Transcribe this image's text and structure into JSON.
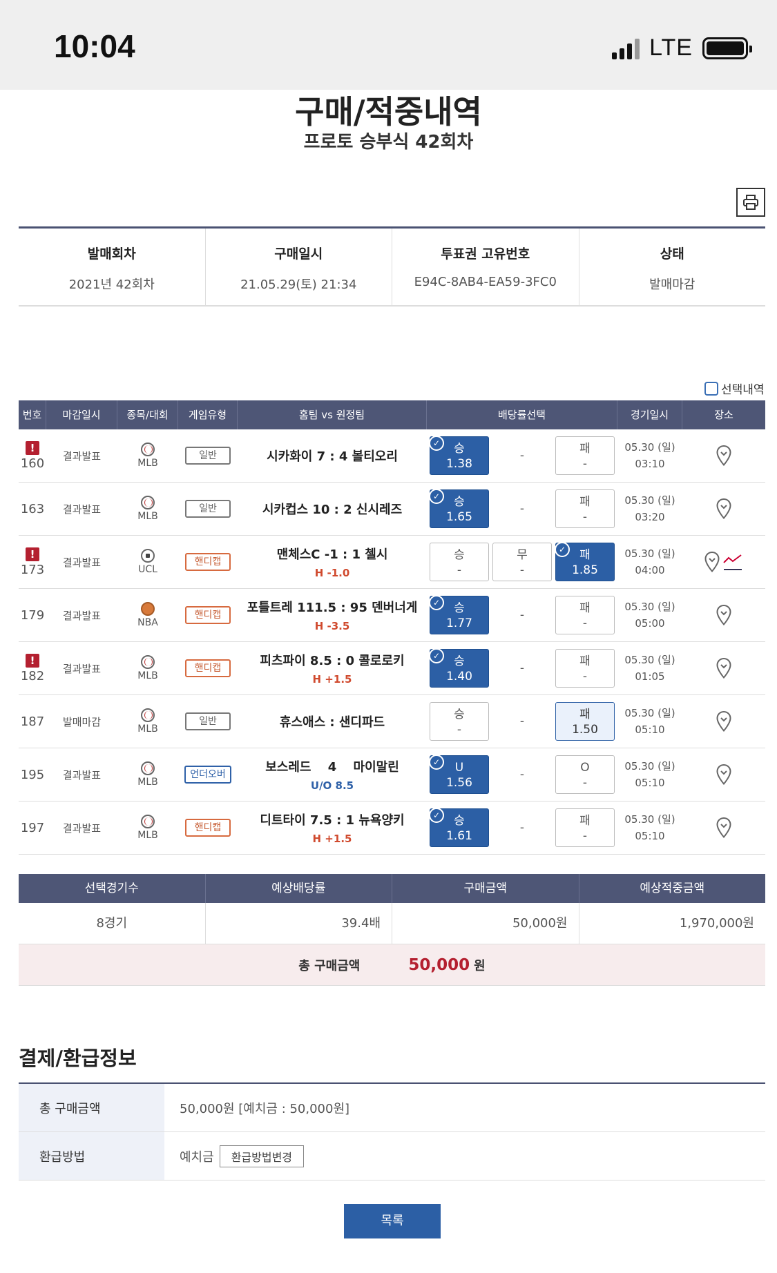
{
  "status_bar": {
    "time": "10:04",
    "network": "LTE"
  },
  "header": {
    "title": "구매/적중내역",
    "subtitle": "프로토 승부식 42회차"
  },
  "info": [
    {
      "label": "발매회차",
      "value": "2021년 42회차"
    },
    {
      "label": "구매일시",
      "value": "21.05.29(토) 21:34"
    },
    {
      "label": "투표권 고유번호",
      "value": "E94C-8AB4-EA59-3FC0"
    },
    {
      "label": "상태",
      "value": "발매마감"
    }
  ],
  "select_label": "선택내역",
  "table": {
    "headers": [
      "번호",
      "마감일시",
      "종목/대회",
      "게임유형",
      "홈팀 vs 원정팀",
      "배당률선택",
      "경기일시",
      "장소"
    ],
    "rows": [
      {
        "no": "160",
        "warn": true,
        "status": "결과발표",
        "league": "MLB",
        "sport": "ball",
        "type": "일반",
        "tk": "",
        "match": "시카화이 7 : 4 볼티오리",
        "sub": "",
        "o1": {
          "l": "승",
          "v": "1.38",
          "s": "sel"
        },
        "o2": {
          "l": "",
          "v": "-",
          "s": "dash"
        },
        "o3": {
          "l": "패",
          "v": "-",
          "s": ""
        },
        "date": "05.30 (일)",
        "time": "03:10"
      },
      {
        "no": "163",
        "warn": false,
        "status": "결과발표",
        "league": "MLB",
        "sport": "ball",
        "type": "일반",
        "tk": "",
        "match": "시카컵스 10 : 2 신시레즈",
        "sub": "",
        "o1": {
          "l": "승",
          "v": "1.65",
          "s": "sel"
        },
        "o2": {
          "l": "",
          "v": "-",
          "s": "dash"
        },
        "o3": {
          "l": "패",
          "v": "-",
          "s": ""
        },
        "date": "05.30 (일)",
        "time": "03:20"
      },
      {
        "no": "173",
        "warn": true,
        "status": "결과발표",
        "league": "UCL",
        "sport": "soccer",
        "type": "핸디캡",
        "tk": "hc",
        "match": "맨체스C -1 : 1 첼시",
        "sub": "H -1.0",
        "o1": {
          "l": "승",
          "v": "-",
          "s": ""
        },
        "o2": {
          "l": "무",
          "v": "-",
          "s": "box"
        },
        "o3": {
          "l": "패",
          "v": "1.85",
          "s": "sel"
        },
        "date": "05.30 (일)",
        "time": "04:00"
      },
      {
        "no": "179",
        "warn": false,
        "status": "결과발표",
        "league": "NBA",
        "sport": "nba",
        "type": "핸디캡",
        "tk": "hc",
        "match": "포틀트레 111.5 : 95 덴버너게",
        "sub": "H -3.5",
        "o1": {
          "l": "승",
          "v": "1.77",
          "s": "sel"
        },
        "o2": {
          "l": "",
          "v": "-",
          "s": "dash"
        },
        "o3": {
          "l": "패",
          "v": "-",
          "s": ""
        },
        "date": "05.30 (일)",
        "time": "05:00"
      },
      {
        "no": "182",
        "warn": true,
        "status": "결과발표",
        "league": "MLB",
        "sport": "ball",
        "type": "핸디캡",
        "tk": "hc",
        "match": "피츠파이 8.5 : 0 콜로로키",
        "sub": "H +1.5",
        "o1": {
          "l": "승",
          "v": "1.40",
          "s": "sel"
        },
        "o2": {
          "l": "",
          "v": "-",
          "s": "dash"
        },
        "o3": {
          "l": "패",
          "v": "-",
          "s": ""
        },
        "date": "05.30 (일)",
        "time": "01:05"
      },
      {
        "no": "187",
        "warn": false,
        "status": "발매마감",
        "league": "MLB",
        "sport": "ball",
        "type": "일반",
        "tk": "",
        "match": "휴스애스 : 샌디파드",
        "sub": "",
        "o1": {
          "l": "승",
          "v": "-",
          "s": ""
        },
        "o2": {
          "l": "",
          "v": "-",
          "s": "dash"
        },
        "o3": {
          "l": "패",
          "v": "1.50",
          "s": "hl"
        },
        "date": "05.30 (일)",
        "time": "05:10"
      },
      {
        "no": "195",
        "warn": false,
        "status": "결과발표",
        "league": "MLB",
        "sport": "ball",
        "type": "언더오버",
        "tk": "uo",
        "match": "보스레드　 4 　마이말린",
        "sub": "U/O 8.5",
        "o1": {
          "l": "U",
          "v": "1.56",
          "s": "sel"
        },
        "o2": {
          "l": "",
          "v": "-",
          "s": "dash"
        },
        "o3": {
          "l": "O",
          "v": "-",
          "s": ""
        },
        "date": "05.30 (일)",
        "time": "05:10"
      },
      {
        "no": "197",
        "warn": false,
        "status": "결과발표",
        "league": "MLB",
        "sport": "ball",
        "type": "핸디캡",
        "tk": "hc",
        "match": "디트타이 7.5 : 1 뉴욕양키",
        "sub": "H +1.5",
        "o1": {
          "l": "승",
          "v": "1.61",
          "s": "sel"
        },
        "o2": {
          "l": "",
          "v": "-",
          "s": "dash"
        },
        "o3": {
          "l": "패",
          "v": "-",
          "s": ""
        },
        "date": "05.30 (일)",
        "time": "05:10"
      }
    ]
  },
  "summary": {
    "headers": [
      "선택경기수",
      "예상배당률",
      "구매금액",
      "예상적중금액"
    ],
    "values": [
      "8경기",
      "39.4배",
      "50,000원",
      "1,970,000원"
    ],
    "total_label": "총 구매금액",
    "total_amount": "50,000",
    "total_unit": "원"
  },
  "payment": {
    "title": "결제/환급정보",
    "total_label": "총 구매금액",
    "total_value": "50,000원 [예치금 : 50,000원]",
    "refund_label": "환급방법",
    "refund_value": "예치금",
    "refund_button": "환급방법변경"
  },
  "list_button": "목록",
  "colors": {
    "header_bg": "#4e5676",
    "selected": "#2c5fa5",
    "accent_red": "#b42030"
  }
}
